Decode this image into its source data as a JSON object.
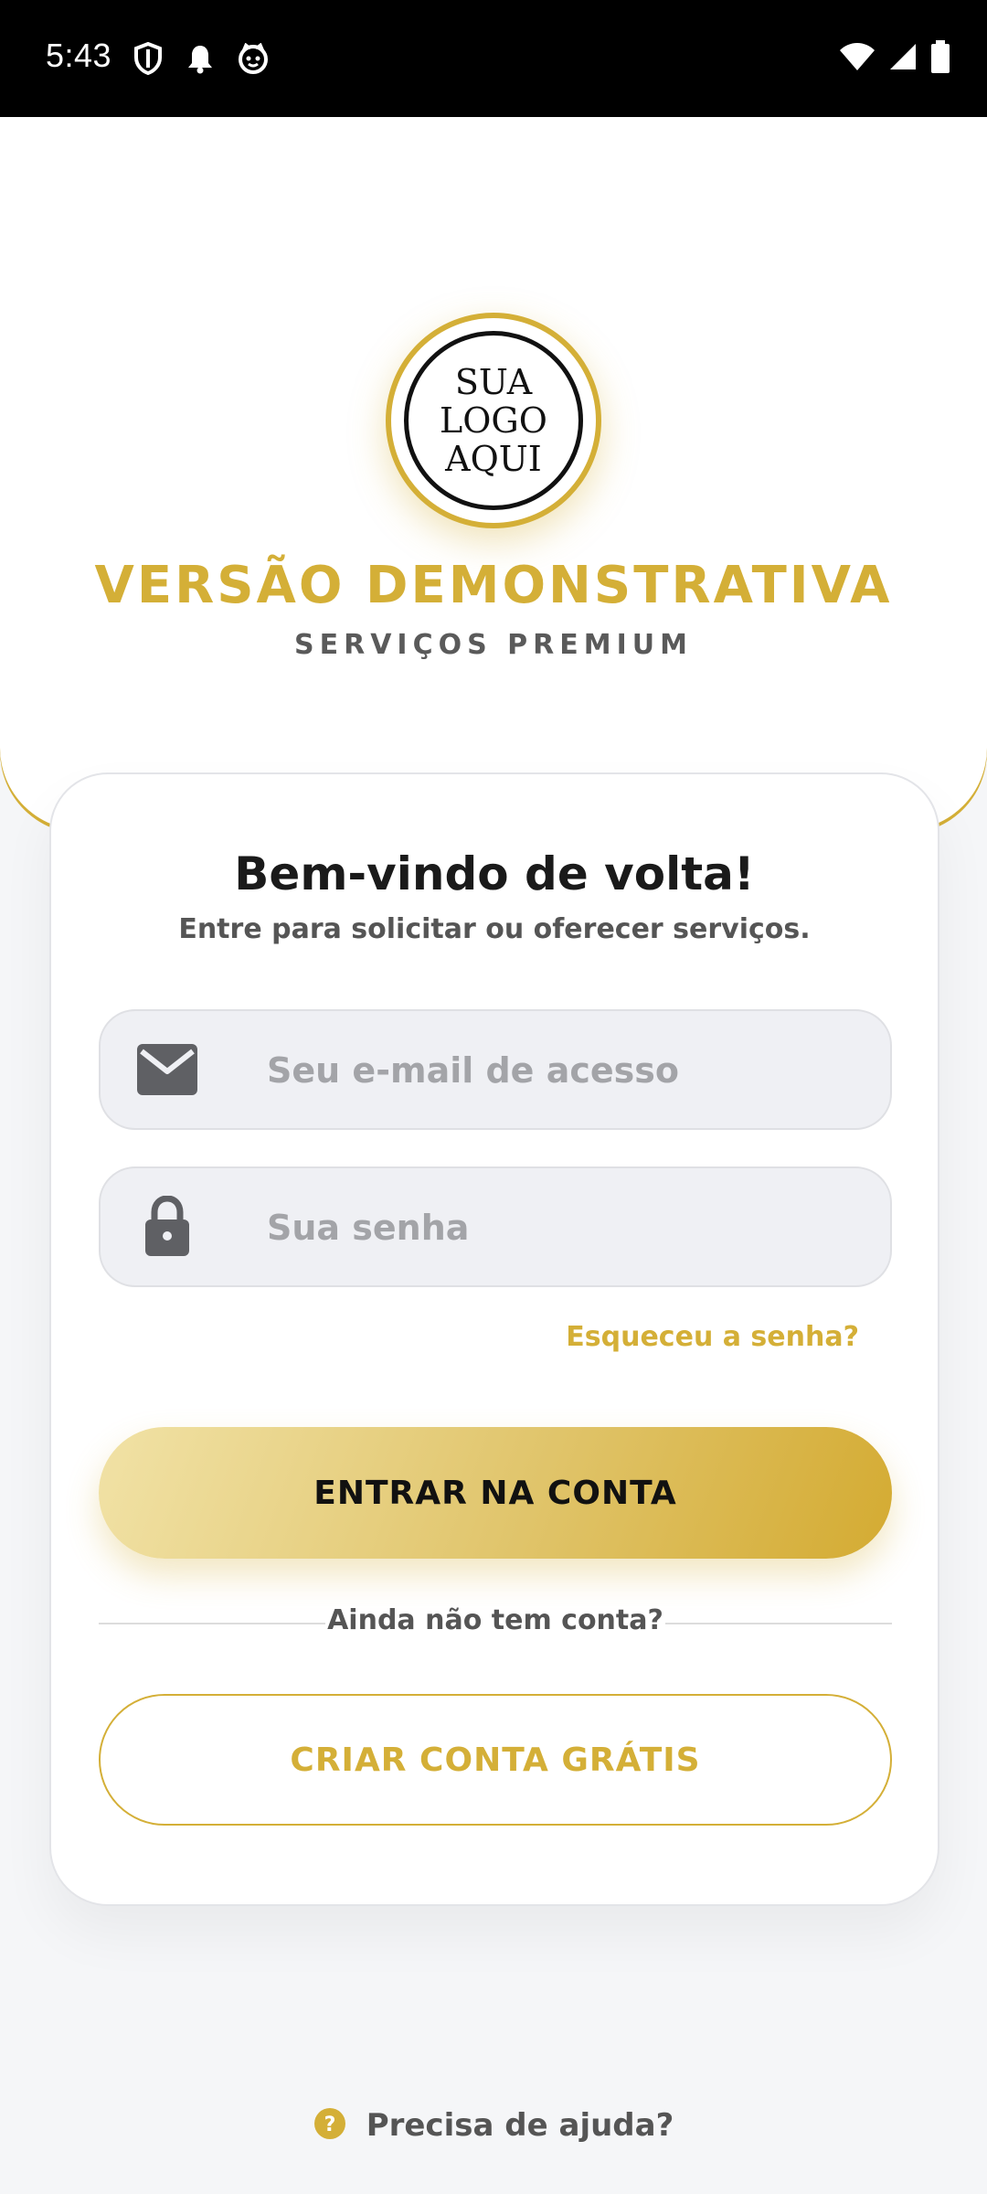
{
  "status_bar": {
    "time": "5:43",
    "left_icons": [
      "shield-icon",
      "notification-bell-icon",
      "cat-face-icon"
    ],
    "right_icons": [
      "wifi-icon",
      "cellular-signal-icon",
      "battery-icon"
    ]
  },
  "brand": {
    "logo_lines": [
      "SUA",
      "LOGO",
      "AQUI"
    ],
    "title": "VERSÃO DEMONSTRATIVA",
    "subtitle": "SERVIÇOS PREMIUM",
    "accent_color": "#d4af37"
  },
  "login": {
    "title": "Bem-vindo de volta!",
    "subtitle": "Entre para solicitar ou oferecer serviços.",
    "email": {
      "placeholder": "Seu e-mail de acesso",
      "value": "",
      "icon": "envelope-icon"
    },
    "password": {
      "placeholder": "Sua senha",
      "value": "",
      "icon": "lock-icon"
    },
    "forgot_label": "Esqueceu a senha?",
    "submit_label": "ENTRAR NA CONTA",
    "divider_label": "Ainda não tem conta?",
    "signup_label": "CRIAR CONTA GRÁTIS"
  },
  "help": {
    "label": "Precisa de ajuda?",
    "icon": "help-circle-icon"
  }
}
